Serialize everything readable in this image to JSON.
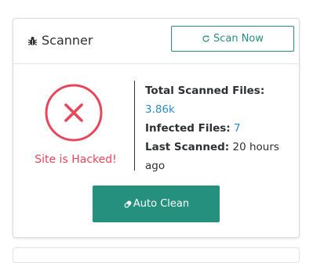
{
  "header": {
    "icon": "bug-icon",
    "title": "Scanner",
    "scan_button": {
      "icon": "refresh-icon",
      "label": "Scan Now"
    }
  },
  "status": {
    "icon": "x-circle-icon",
    "text": "Site is Hacked!",
    "color": "#e8475b"
  },
  "stats": {
    "total_label": "Total Scanned Files:",
    "total_value": "3.86k",
    "infected_label": "Infected Files:",
    "infected_value": "7",
    "last_label": "Last Scanned:",
    "last_value": "20 hours ago"
  },
  "auto_clean_button": {
    "icon": "eraser-icon",
    "label": "Auto Clean"
  },
  "colors": {
    "accent": "#26907f",
    "danger": "#e8475b",
    "link": "#2d8bc9"
  }
}
